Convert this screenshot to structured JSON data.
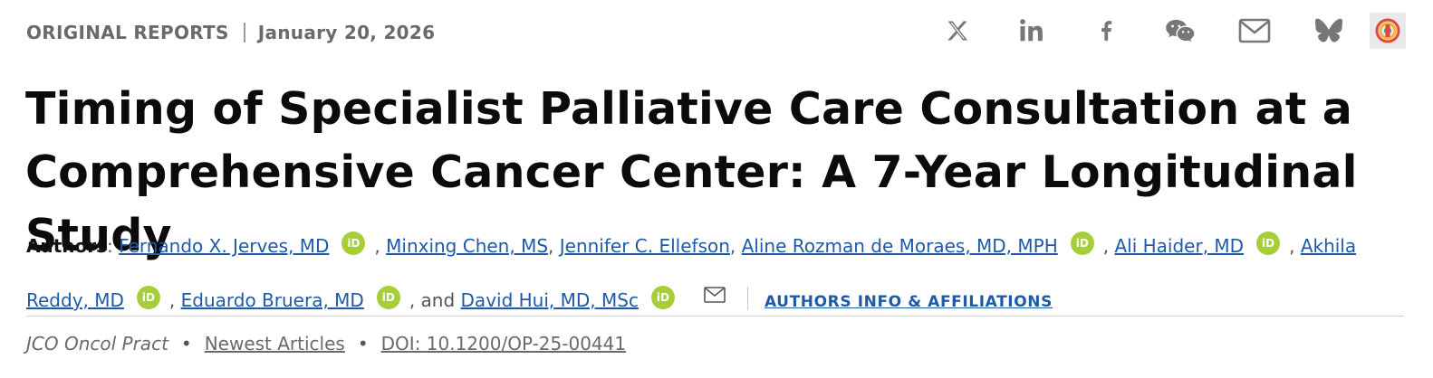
{
  "meta": {
    "article_type": "ORIGINAL REPORTS",
    "date": "January 20, 2026"
  },
  "share": {
    "icons": [
      "x-icon",
      "linkedin-icon",
      "facebook-icon",
      "wechat-icon",
      "email-icon",
      "bluesky-icon",
      "altmetric-icon"
    ]
  },
  "title": "Timing of Specialist Palliative Care Consultation at a Comprehensive Cancer Center: A 7-Year Longitudinal Study",
  "authors": {
    "label": "Authors",
    "colon": ":",
    "list": [
      "Fernando X. Jerves, MD",
      "Minxing Chen, MS",
      "Jennifer C. Ellefson",
      "Aline Rozman de Moraes, MD, MPH",
      "Ali Haider, MD",
      "Akhila Reddy, MD",
      "Eduardo Bruera, MD",
      "David Hui, MD, MSc"
    ],
    "orcid_badge": "iD",
    "comma": ",",
    "and_text": ", and",
    "affiliations_link": "AUTHORS INFO & AFFILIATIONS"
  },
  "footer": {
    "journal": "JCO Oncol Pract",
    "bullet": "•",
    "section": "Newest Articles",
    "doi": "DOI: 10.1200/OP-25-00441"
  },
  "colors": {
    "link": "#1f5aa6",
    "orcid": "#a6ce39",
    "muted": "#6a6a6a"
  }
}
